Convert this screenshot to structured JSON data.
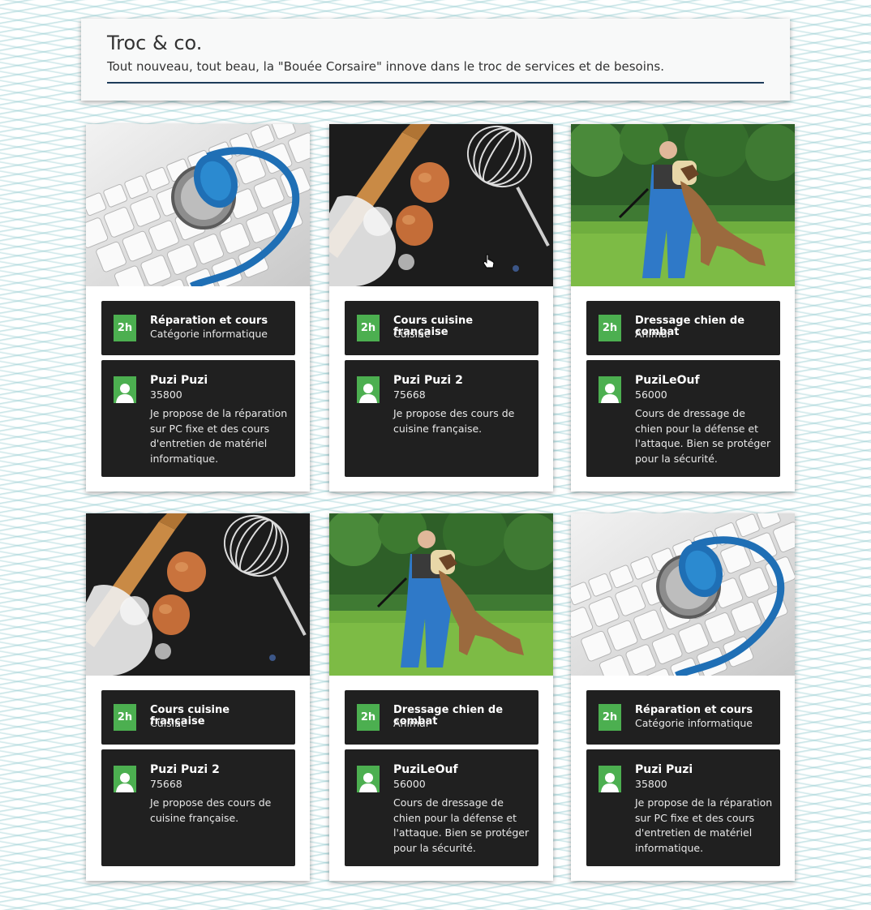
{
  "header": {
    "title": "Troc & co.",
    "subtitle": "Tout nouveau, tout beau, la \"Bouée Corsaire\" innove dans le troc de services et de besoins."
  },
  "colors": {
    "badge": "#4caf50",
    "panel": "#202020",
    "header_rule": "#1e3c5a"
  },
  "cards": [
    {
      "image": "keyboard-stethoscope",
      "duration": "2h",
      "title": "Réparation et cours",
      "category": "Catégorie informatique",
      "user": "Puzi Puzi",
      "zip": "35800",
      "description": "Je propose de la réparation sur PC fixe et des cours d'entretien de matériel informatique."
    },
    {
      "image": "cooking-eggs-whisk",
      "duration": "2h",
      "title": "Cours cuisine française",
      "category": "Cuisine",
      "user": "Puzi Puzi 2",
      "zip": "75668",
      "description": "Je propose des cours de cuisine française."
    },
    {
      "image": "dog-training",
      "duration": "2h",
      "title": "Dressage chien de combat",
      "category": "Animal",
      "user": "PuziLeOuf",
      "zip": "56000",
      "description": "Cours de dressage de chien pour la défense et l'attaque. Bien se protéger pour la sécurité."
    },
    {
      "image": "cooking-eggs-whisk",
      "duration": "2h",
      "title": "Cours cuisine française",
      "category": "Cuisine",
      "user": "Puzi Puzi 2",
      "zip": "75668",
      "description": "Je propose des cours de cuisine française."
    },
    {
      "image": "dog-training",
      "duration": "2h",
      "title": "Dressage chien de combat",
      "category": "Animal",
      "user": "PuziLeOuf",
      "zip": "56000",
      "description": "Cours de dressage de chien pour la défense et l'attaque. Bien se protéger pour la sécurité."
    },
    {
      "image": "keyboard-stethoscope",
      "duration": "2h",
      "title": "Réparation et cours",
      "category": "Catégorie informatique",
      "user": "Puzi Puzi",
      "zip": "35800",
      "description": "Je propose de la réparation sur PC fixe et des cours d'entretien de matériel informatique."
    }
  ]
}
